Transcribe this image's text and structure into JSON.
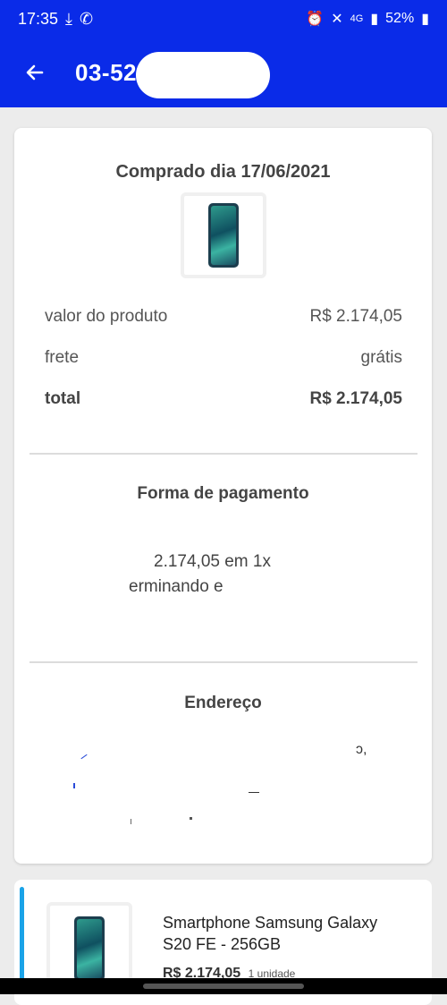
{
  "status_bar": {
    "time": "17:35",
    "battery": "52%",
    "network": "4G"
  },
  "header": {
    "order_id": "03-529"
  },
  "summary": {
    "purchased_on": "Comprado dia 17/06/2021",
    "rows": [
      {
        "label": "valor do produto",
        "value": "R$ 2.174,05"
      },
      {
        "label": "frete",
        "value": "grátis"
      },
      {
        "label": "total",
        "value": "R$ 2.174,05"
      }
    ]
  },
  "payment": {
    "title": "Forma de pagamento",
    "line1": "2.174,05 em 1x",
    "line2": "erminando e"
  },
  "address": {
    "title": "Endereço"
  },
  "product": {
    "name": "Smartphone Samsung Galaxy S20 FE - 256GB",
    "price": "R$ 2.174,05",
    "quantity": "1 unidade"
  },
  "colors": {
    "primary": "#0a2be8",
    "accent": "#1aa3e8"
  }
}
